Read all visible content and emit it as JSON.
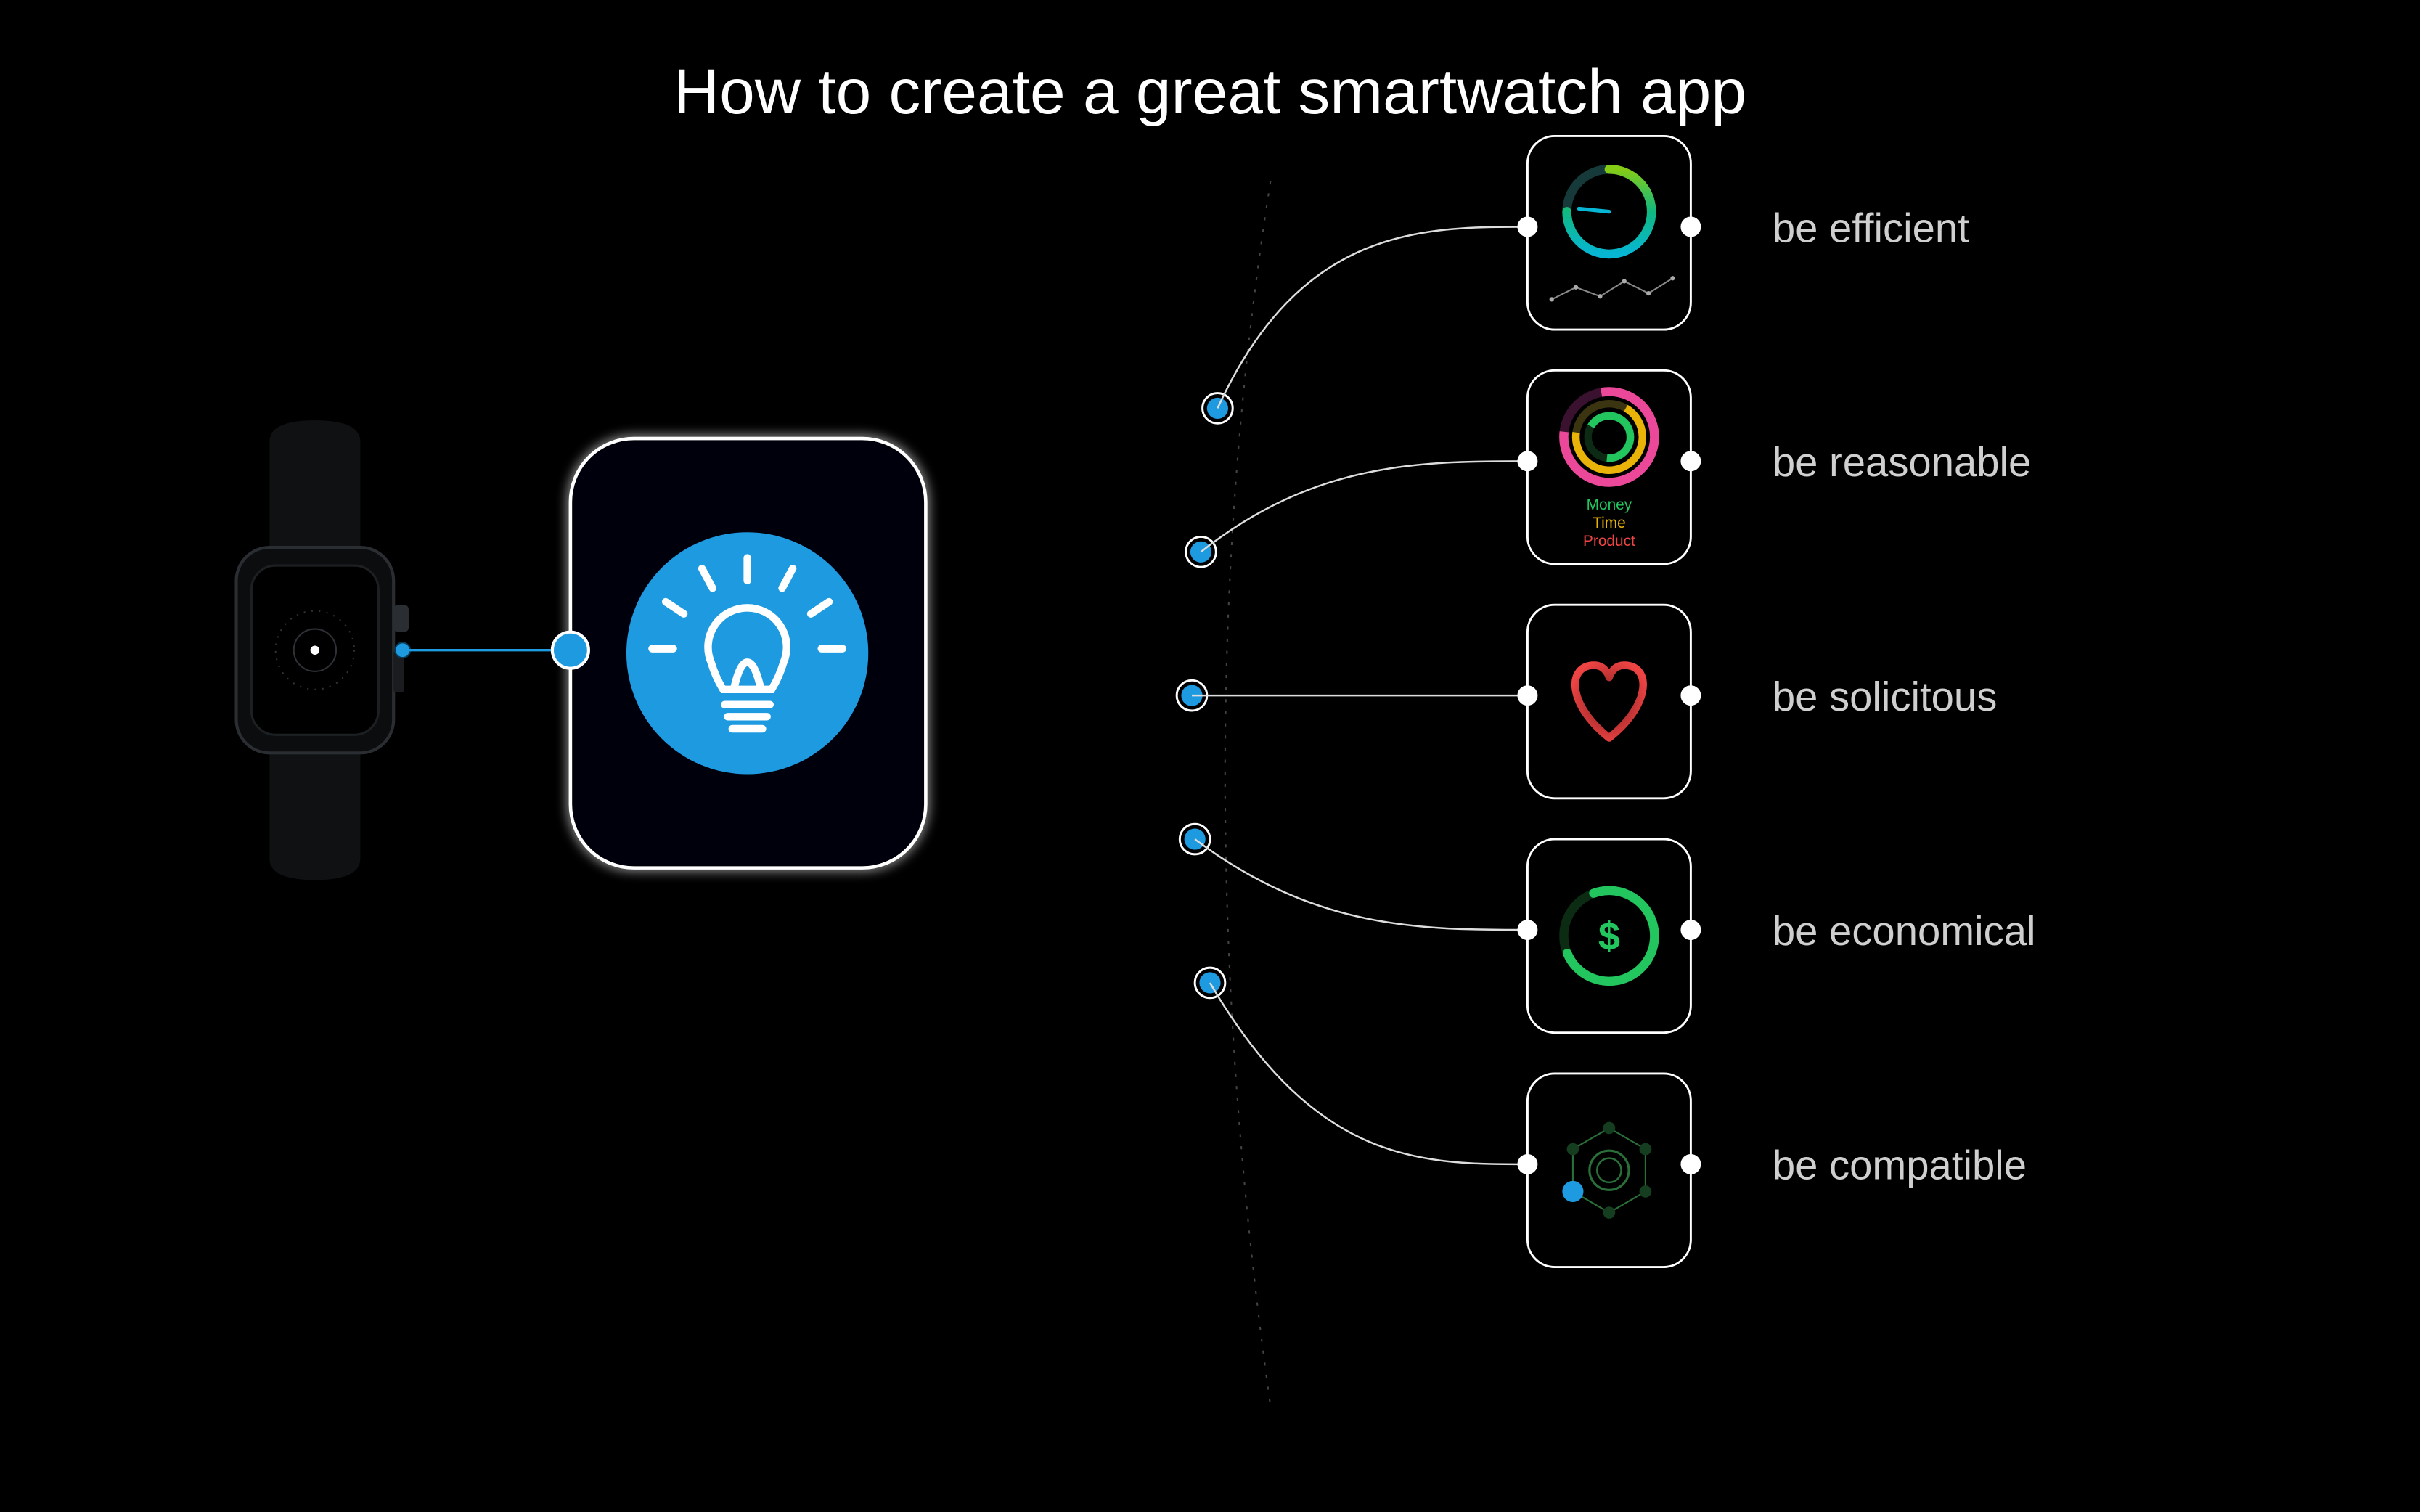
{
  "title": "How to create a great smartwatch app",
  "tiles": [
    {
      "label": "be efficient"
    },
    {
      "label": "be reasonable"
    },
    {
      "label": "be solicitous"
    },
    {
      "label": "be economical"
    },
    {
      "label": "be compatible"
    }
  ],
  "reasonable_legend": {
    "money": "Money",
    "time": "Time",
    "product": "Product"
  },
  "colors": {
    "accent": "#1e9ae0",
    "money": "#22c55e",
    "time": "#eab308",
    "product": "#ef4444"
  }
}
